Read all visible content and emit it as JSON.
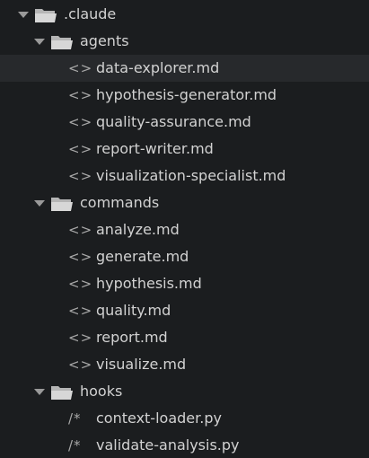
{
  "tree": {
    "root": {
      "name": ".claude",
      "expanded": true,
      "icon": "folder-open-icon"
    },
    "folders": [
      {
        "name": "agents",
        "expanded": true,
        "icon": "folder-open-icon",
        "files": [
          {
            "name": "data-explorer.md",
            "glyph": "<>",
            "icon": "markdown-file-icon",
            "selected": true
          },
          {
            "name": "hypothesis-generator.md",
            "glyph": "<>",
            "icon": "markdown-file-icon"
          },
          {
            "name": "quality-assurance.md",
            "glyph": "<>",
            "icon": "markdown-file-icon"
          },
          {
            "name": "report-writer.md",
            "glyph": "<>",
            "icon": "markdown-file-icon"
          },
          {
            "name": "visualization-specialist.md",
            "glyph": "<>",
            "icon": "markdown-file-icon"
          }
        ]
      },
      {
        "name": "commands",
        "expanded": true,
        "icon": "folder-open-icon",
        "files": [
          {
            "name": "analyze.md",
            "glyph": "<>",
            "icon": "markdown-file-icon"
          },
          {
            "name": "generate.md",
            "glyph": "<>",
            "icon": "markdown-file-icon"
          },
          {
            "name": "hypothesis.md",
            "glyph": "<>",
            "icon": "markdown-file-icon"
          },
          {
            "name": "quality.md",
            "glyph": "<>",
            "icon": "markdown-file-icon"
          },
          {
            "name": "report.md",
            "glyph": "<>",
            "icon": "markdown-file-icon"
          },
          {
            "name": "visualize.md",
            "glyph": "<>",
            "icon": "markdown-file-icon"
          }
        ]
      },
      {
        "name": "hooks",
        "expanded": true,
        "icon": "folder-open-icon",
        "files": [
          {
            "name": "context-loader.py",
            "glyph": "/*",
            "icon": "python-file-icon"
          },
          {
            "name": "validate-analysis.py",
            "glyph": "/*",
            "icon": "python-file-icon"
          }
        ]
      }
    ]
  },
  "colors": {
    "background": "#1b1d1f",
    "selected_row": "#27292c",
    "text": "#d2d2d2",
    "icon": "#9a9a9a"
  }
}
